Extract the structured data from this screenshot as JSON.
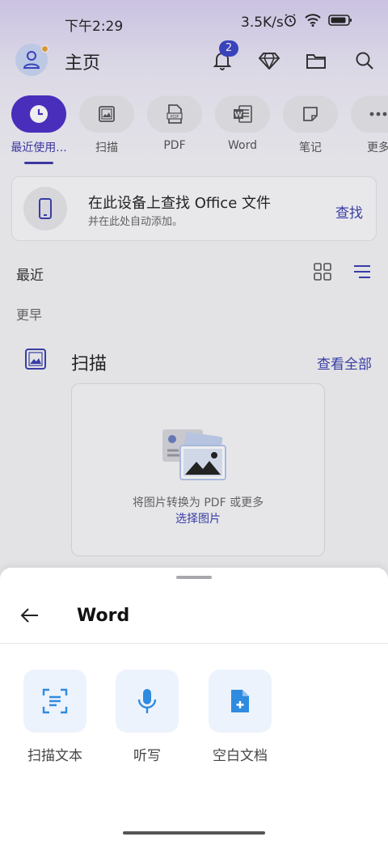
{
  "status_bar": {
    "time": "下午2:29",
    "network_speed": "3.5K/s",
    "icons": [
      "alarm-icon",
      "wifi-icon",
      "battery-icon"
    ]
  },
  "header": {
    "title": "主页",
    "notification_count": "2",
    "icons": [
      "avatar-icon",
      "bell-icon",
      "premium-diamond-icon",
      "folder-icon",
      "search-icon"
    ]
  },
  "chips": [
    {
      "label": "最近使用...",
      "icon": "clock-icon",
      "active": true
    },
    {
      "label": "扫描",
      "icon": "image-icon",
      "active": false
    },
    {
      "label": "PDF",
      "icon": "pdf-icon",
      "active": false
    },
    {
      "label": "Word",
      "icon": "word-icon",
      "active": false
    },
    {
      "label": "笔记",
      "icon": "note-icon",
      "active": false
    },
    {
      "label": "更多",
      "icon": "more-icon",
      "active": false
    }
  ],
  "find_card": {
    "title": "在此设备上查找 Office 文件",
    "subtitle": "并在此处自动添加。",
    "action": "查找"
  },
  "recent": {
    "label": "最近",
    "earlier_label": "更早"
  },
  "scan_section": {
    "title": "扫描",
    "see_all": "查看全部",
    "caption": "将图片转换为 PDF 或更多",
    "pick_link": "选择图片"
  },
  "sheet": {
    "title": "Word",
    "options": [
      {
        "label": "扫描文本",
        "icon": "scan-text-icon"
      },
      {
        "label": "听写",
        "icon": "microphone-icon"
      },
      {
        "label": "空白文档",
        "icon": "blank-document-icon"
      }
    ]
  },
  "colors": {
    "accent": "#3a3fae",
    "active_chip": "#4c2fc7",
    "sheet_icon": "#2f8be0",
    "tile_bg": "#edf3fc"
  }
}
